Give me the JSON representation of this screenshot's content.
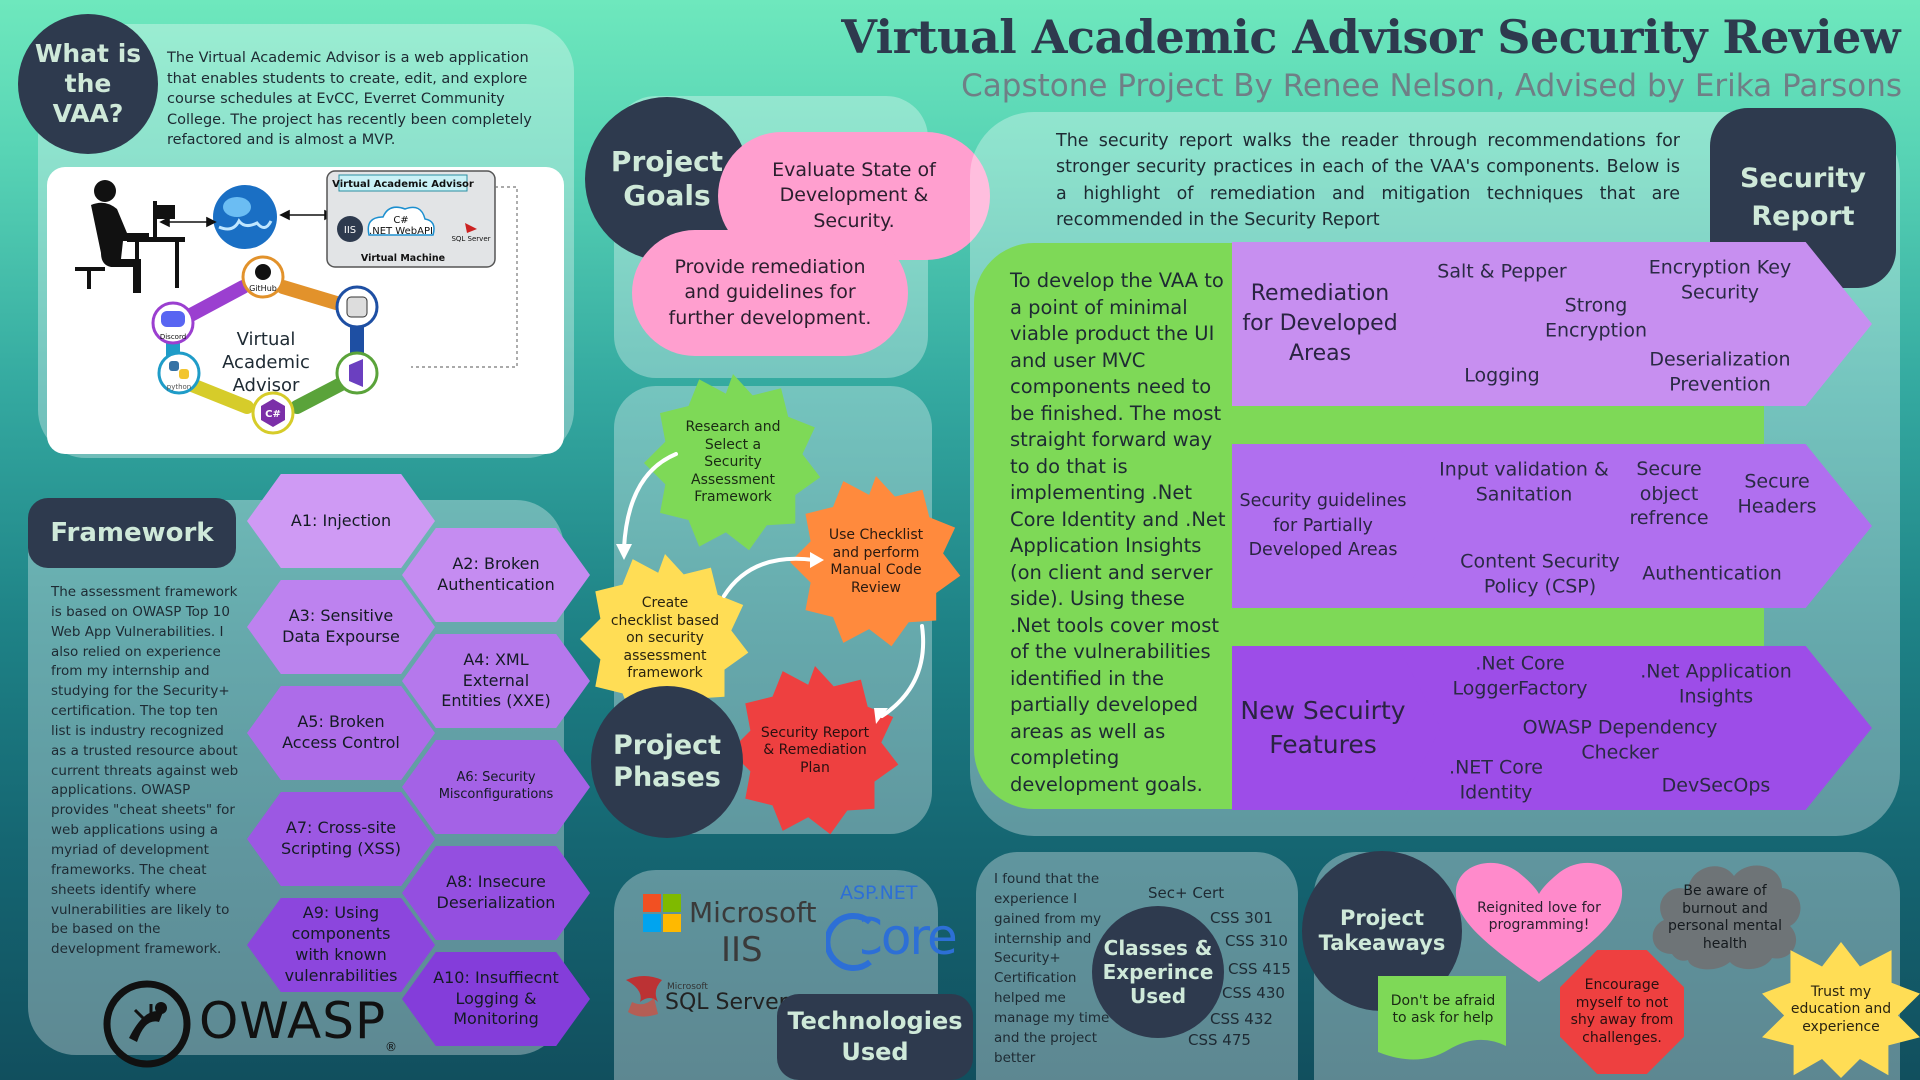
{
  "header": {
    "title": "Virtual Academic Advisor Security Review",
    "subtitle": "Capstone Project By Renee Nelson, Advised by Erika Parsons"
  },
  "what_is": {
    "heading": "What is the VAA?",
    "text": "The Virtual Academic Advisor is a web application that enables students to create, edit, and explore course schedules at EvCC, Everret Community College. The project has recently been completely refactored and is almost a MVP.",
    "diagram": {
      "vm_title": "Virtual Academic Advisor",
      "iis": "IIS",
      "csharp": "C#",
      "webapi": ".NET WebAPI",
      "sql": "SQL Server",
      "vm_label": "Virtual Machine",
      "center": "Virtual Academic Advisor",
      "github": "GitHub",
      "discord": "Discord",
      "python": "python"
    }
  },
  "framework": {
    "heading": "Framework",
    "text": "The assessment framework is based on OWASP Top 10 Web App Vulnerabilities. I also relied on experience from my internship and studying for the Security+ certification. The top ten list is industry recognized as a trusted resource about current threats against web applications. OWASP provides \"cheat sheets\" for web applications using a myriad of development frameworks. The cheat sheets identify where vulnerabilities are likely to be based on the development framework.",
    "items": [
      "A1: Injection",
      "A2: Broken Authentication",
      "A3: Sensitive Data Expourse",
      "A4: XML External Entities (XXE)",
      "A5: Broken Access Control",
      "A6: Security Misconfigurations",
      "A7: Cross-site Scripting (XSS)",
      "A8: Insecure Deserialization",
      "A9: Using components with known vulenrabilities",
      "A10: Insuffiecnt Logging & Monitoring"
    ],
    "logo": "OWASP",
    "logo_mark": "®"
  },
  "goals": {
    "heading": "Project Goals",
    "goal1": "Evaluate State of Development & Security.",
    "goal2": "Provide remediation and guidelines for further development."
  },
  "phases": {
    "heading": "Project Phases",
    "steps": [
      "Research and Select a Security Assessment Framework",
      "Use Checklist and perform Manual Code Review",
      "Create checklist based on security assessment framework",
      "Security Report & Remediation Plan"
    ]
  },
  "tech": {
    "heading": "Technologies Used",
    "microsoft": "Microsoft",
    "iis": "IIS",
    "aspnet": "ASP.NET",
    "core": "Core",
    "sql_small": "Microsoft",
    "sql": "SQL Server"
  },
  "report": {
    "heading": "Security Report",
    "intro": "The security report walks the reader through recommendations for stronger security practices in each of the VAA's components. Below is a highlight of remediation and mitigation techniques that are recommended in the Security Report",
    "body": "To develop the VAA to a point of minimal viable product the UI and user MVC components need to be finished. The most straight forward way to do that is implementing .Net Core Identity and .Net Application Insights (on client and server side). Using these .Net tools cover most of the vulnerabilities identified in the partially developed areas as well as completing development goals.",
    "rows": [
      {
        "label": "Remediation for Developed Areas",
        "items": [
          "Salt & Pepper",
          "Encryption Key Security",
          "Strong Encryption",
          "Logging",
          "Deserialization Prevention"
        ]
      },
      {
        "label": "Security guidelines for Partially Developed Areas",
        "items": [
          "Input validation & Sanitation",
          "Secure object refrence",
          "Secure Headers",
          "Content Security Policy (CSP)",
          "Authentication"
        ]
      },
      {
        "label": "New Secuirty Features",
        "items": [
          ".Net Core LoggerFactory",
          ".Net Application Insights",
          "OWASP Dependency Checker",
          ".NET Core Identity",
          "DevSecOps"
        ]
      }
    ]
  },
  "classes": {
    "heading": "Classes & Experince Used",
    "text": "I found that the experience I gained from my internship and Security+ Certification helped me manage my time and the project better",
    "cert": "Sec+ Cert",
    "courses": [
      "CSS 301",
      "CSS 310",
      "CSS 415",
      "CSS 430",
      "CSS 432",
      "CSS 475"
    ]
  },
  "takeaways": {
    "heading": "Project Takeaways",
    "items": [
      "Reignited love for programming!",
      "Be aware of burnout and personal mental health",
      "Don't be afraid to ask for help",
      "Encourage myself to not shy away from challenges.",
      "Trust my education and experience"
    ]
  },
  "colors": {
    "dark_circle": "#2e3a4e",
    "pink": "#ff9fcf",
    "green": "#7ed957",
    "lavender": "#c78ff0",
    "violet": "#9d4de8",
    "orange": "#ff8a3d",
    "red": "#ee4040",
    "yellow": "#ffdd55"
  }
}
